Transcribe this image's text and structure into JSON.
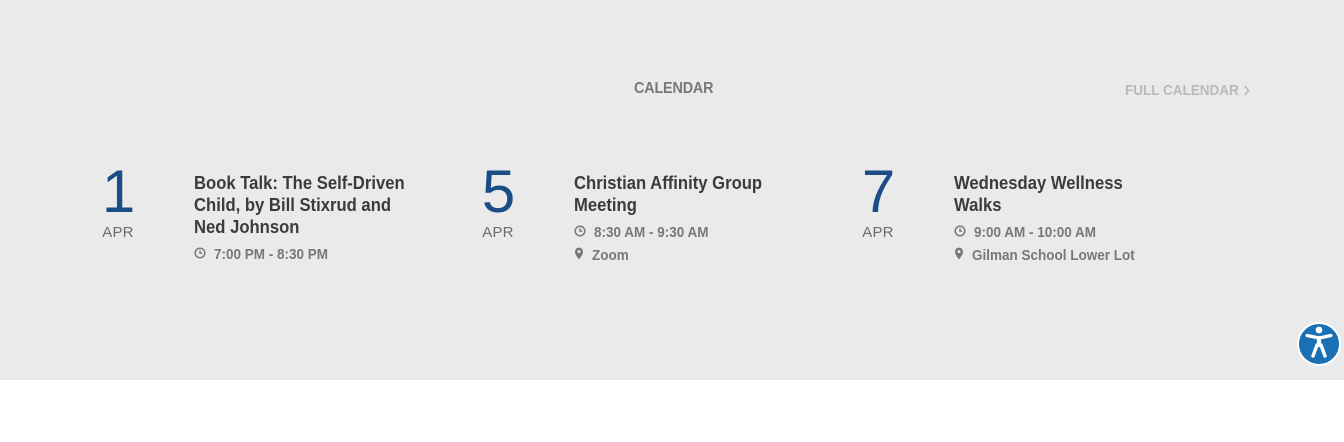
{
  "calendar": {
    "heading": "CALENDAR",
    "full_calendar_label": "FULL CALENDAR",
    "events": [
      {
        "day": "1",
        "month": "APR",
        "title": "Book Talk: The Self-Driven Child, by Bill Stixrud and Ned Johnson",
        "time": "7:00 PM - 8:30 PM",
        "location": ""
      },
      {
        "day": "5",
        "month": "APR",
        "title": "Christian Affinity Group Meeting",
        "time": "8:30 AM - 9:30 AM",
        "location": "Zoom"
      },
      {
        "day": "7",
        "month": "APR",
        "title": "Wednesday Wellness Walks",
        "time": "9:00 AM - 10:00 AM",
        "location": "Gilman School Lower Lot"
      }
    ]
  },
  "icons": {
    "time": "clock-icon",
    "location": "map-pin-icon",
    "more": "chevron-right-icon",
    "accessibility": "accessibility-icon"
  },
  "colors": {
    "band_background": "#eaeaea",
    "date_number": "#1b4c87",
    "title_text": "#3a3b3d",
    "meta_text": "#77787b",
    "link_muted": "#b8b9bb",
    "accessibility_button": "#1b6fb3"
  }
}
